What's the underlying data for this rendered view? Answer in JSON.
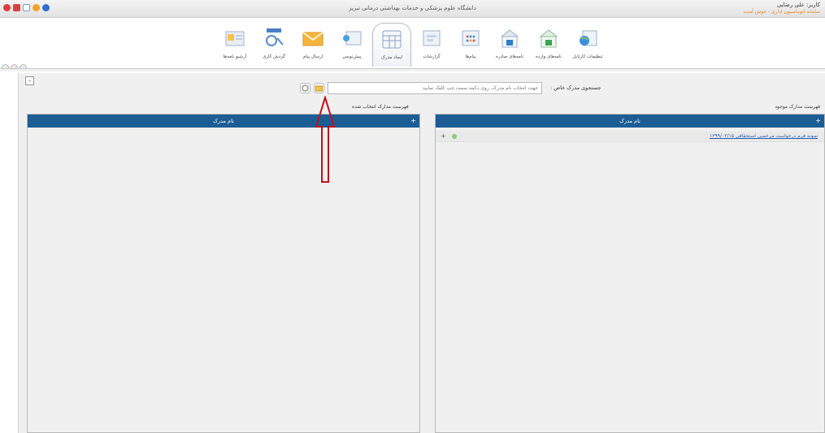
{
  "window": {
    "title": "دانشگاه علوم پزشکی و خدمات بهداشتی درمانی تبریز",
    "user_name": "کاربر: علی رضایی",
    "user_info": "سامانه اتوماسیون اداری - خوش آمدید"
  },
  "ribbon": {
    "items": [
      {
        "label": "تنظیمات کارتابل"
      },
      {
        "label": "نامه‌های وارده"
      },
      {
        "label": "نامه‌های صادره"
      },
      {
        "label": "پیام‌ها"
      },
      {
        "label": "گزارشات"
      },
      {
        "label": "ایجاد مدرک"
      },
      {
        "label": "پیش‌نویس"
      },
      {
        "label": "ارسال پیام"
      },
      {
        "label": "گردش کاری"
      },
      {
        "label": "آرشیو نامه‌ها"
      }
    ]
  },
  "search": {
    "label": "جستجوی مدرک خاص :",
    "placeholder": "جهت انتخاب نام مدرک، روی دکمه سمت چپ کلیک نمایید"
  },
  "right_panel": {
    "caption": "فهرست مدارک موجود",
    "header": "نام مدرک",
    "rows": [
      {
        "text": "نمونه فرم درخواست مرخصی استحقاقی ۱۳۹۹/۰۲/۱۵"
      }
    ]
  },
  "left_panel": {
    "caption": "فهرست مدارک انتخاب شده",
    "header": "نام مدرک"
  },
  "colors": {
    "panel_header": "#1d5d95",
    "arrow": "#c0101a"
  }
}
